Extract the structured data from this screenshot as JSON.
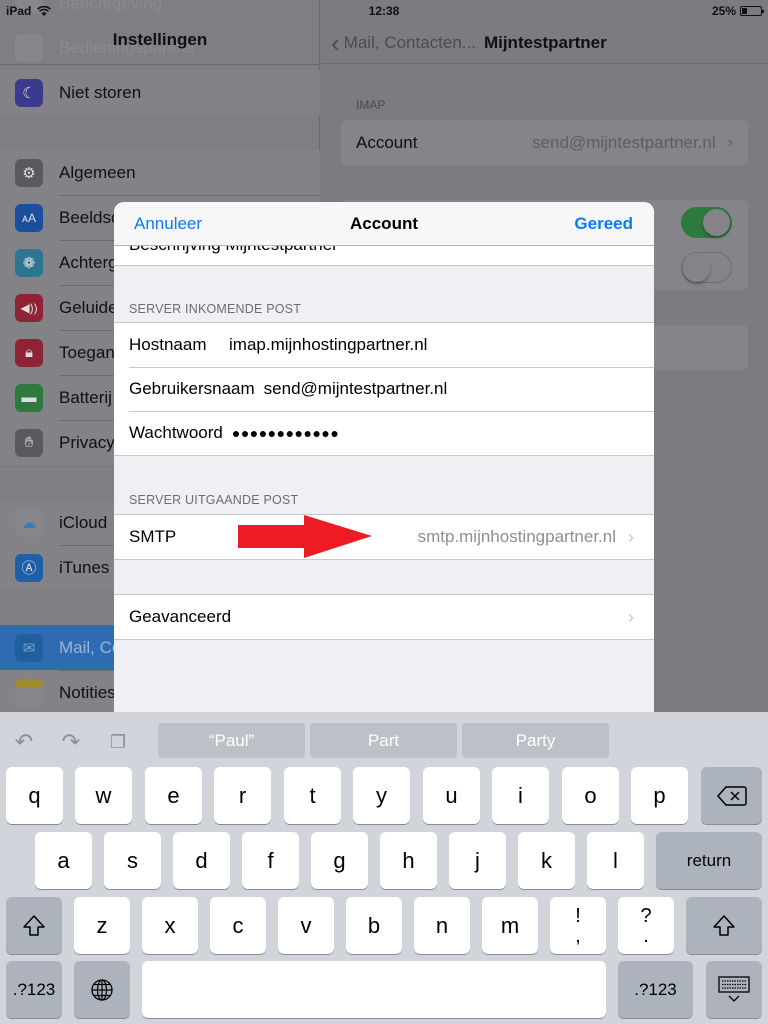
{
  "status_bar": {
    "device": "iPad",
    "time": "12:38",
    "battery": "25%",
    "battery_level_percent": 25
  },
  "left_pane": {
    "title": "Instellingen",
    "ghost_items": [
      "Berichtgeving",
      "Bedieningspaneel"
    ],
    "groups": [
      {
        "items": [
          {
            "label": "Niet storen",
            "icon": "moon-icon",
            "color": "#3b3a8c"
          }
        ]
      },
      {
        "items": [
          {
            "label": "Algemeen",
            "icon": "gear-icon",
            "color": "#5a5a5e"
          },
          {
            "label": "Beeldscherm en helderheid",
            "icon": "text-size-icon",
            "color": "#1a4f9c"
          },
          {
            "label": "Achtergrond",
            "icon": "wallpaper-flower-icon",
            "color": "#2d7593"
          },
          {
            "label": "Geluiden",
            "icon": "speaker-icon",
            "color": "#8f2336"
          },
          {
            "label": "Toegangscode",
            "icon": "lock-icon",
            "color": "#8f2336"
          },
          {
            "label": "Batterij",
            "icon": "battery-icon",
            "color": "#2e7a3e"
          },
          {
            "label": "Privacy",
            "icon": "hand-icon",
            "color": "#5a5a5e"
          }
        ]
      },
      {
        "items": [
          {
            "label": "iCloud",
            "icon": "cloud-icon",
            "color": "#86868b"
          },
          {
            "label": "iTunes en App Store",
            "icon": "app-store-icon",
            "color": "#1e5fa8"
          }
        ]
      },
      {
        "items": [
          {
            "label": "Mail, Contacten, Agenda",
            "icon": "mail-icon",
            "color": "#1f5f9e",
            "selected": true
          },
          {
            "label": "Notities",
            "icon": "notes-icon",
            "color": "#86868b"
          }
        ]
      }
    ]
  },
  "right_pane": {
    "back_label": "Mail, Contacten...",
    "title": "Mijntestpartner",
    "section_header": "IMAP",
    "account_label": "Account",
    "account_value": "send@mijntestpartner.nl",
    "toggles": [
      {
        "state": "on"
      },
      {
        "state": "off"
      }
    ]
  },
  "modal": {
    "cancel_label": "Annuleer",
    "title": "Account",
    "done_label": "Gereed",
    "partial_row": "Beschrijving  Mijntestpartner",
    "incoming_header": "SERVER INKOMENDE POST",
    "incoming_rows": [
      {
        "label": "Hostnaam",
        "value": "imap.mijnhostingpartner.nl"
      },
      {
        "label": "Gebruikersnaam",
        "value": "send@mijntestpartner.nl"
      },
      {
        "label": "Wachtwoord",
        "value": "●●●●●●●●●●●●"
      }
    ],
    "outgoing_header": "SERVER UITGAANDE POST",
    "smtp_label": "SMTP",
    "smtp_value": "smtp.mijnhostingpartner.nl",
    "advanced_label": "Geavanceerd",
    "annotation_arrow_color": "#ed1c24"
  },
  "keyboard": {
    "suggestions": [
      "“Paul”",
      "Part",
      "Party"
    ],
    "row1": [
      "q",
      "w",
      "e",
      "r",
      "t",
      "y",
      "u",
      "i",
      "o",
      "p"
    ],
    "row2": [
      "a",
      "s",
      "d",
      "f",
      "g",
      "h",
      "j",
      "k",
      "l"
    ],
    "row3": [
      "z",
      "x",
      "c",
      "v",
      "b",
      "n",
      "m"
    ],
    "row3_punct": [
      {
        "top": "!",
        "bottom": ","
      },
      {
        "top": "?",
        "bottom": "."
      }
    ],
    "return_label": "return",
    "numbers_label": ".?123"
  }
}
